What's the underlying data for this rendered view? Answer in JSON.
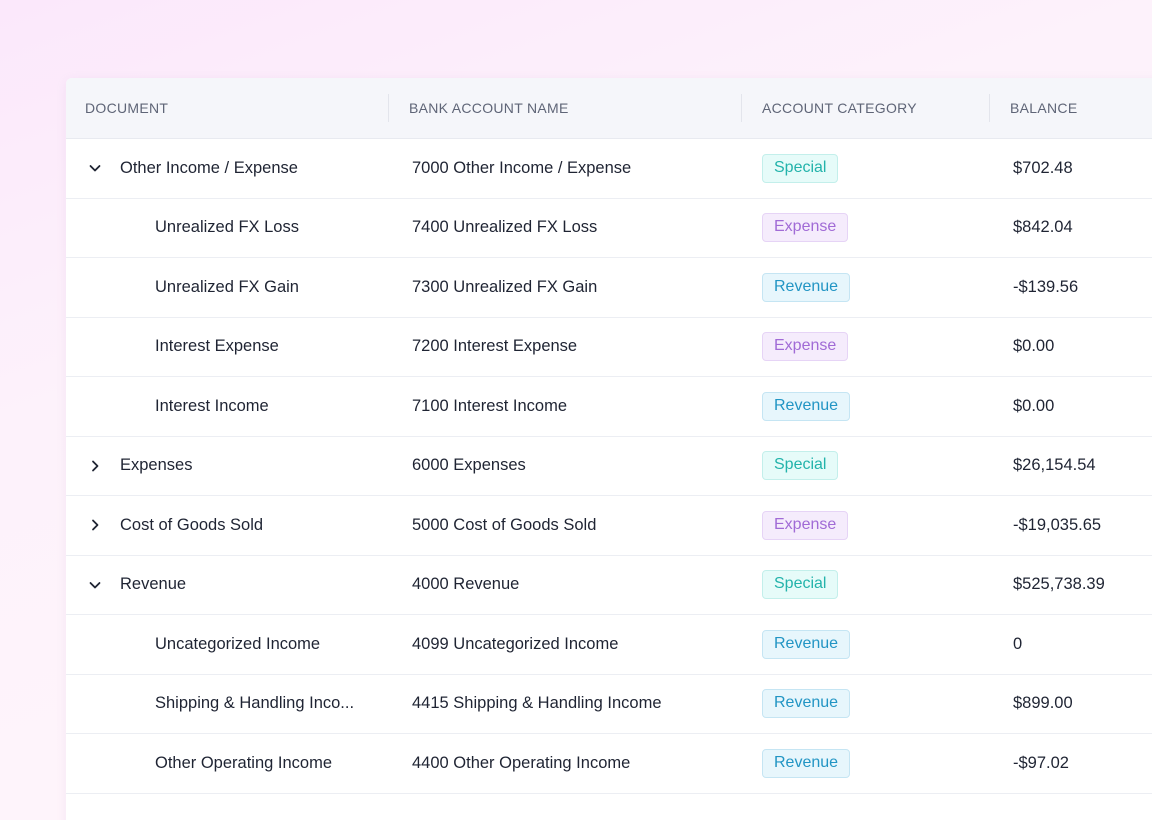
{
  "columns": {
    "document": "DOCUMENT",
    "bank_account_name": "BANK ACCOUNT NAME",
    "account_category": "ACCOUNT CATEGORY",
    "balance": "BALANCE"
  },
  "rows": [
    {
      "document": "Other Income / Expense",
      "account": "7000 Other Income / Expense",
      "category": "Special",
      "balance": "$702.48",
      "expander": "expanded"
    },
    {
      "document": "Unrealized FX Loss",
      "account": "7400 Unrealized FX Loss",
      "category": "Expense",
      "balance": "$842.04",
      "expander": "none"
    },
    {
      "document": "Unrealized FX Gain",
      "account": "7300 Unrealized FX Gain",
      "category": "Revenue",
      "balance": "-$139.56",
      "expander": "none"
    },
    {
      "document": "Interest Expense",
      "account": "7200 Interest Expense",
      "category": "Expense",
      "balance": "$0.00",
      "expander": "none"
    },
    {
      "document": "Interest Income",
      "account": "7100 Interest Income",
      "category": "Revenue",
      "balance": "$0.00",
      "expander": "none"
    },
    {
      "document": "Expenses",
      "account": "6000 Expenses",
      "category": "Special",
      "balance": "$26,154.54",
      "expander": "collapsed"
    },
    {
      "document": "Cost of Goods Sold",
      "account": "5000 Cost of Goods Sold",
      "category": "Expense",
      "balance": "-$19,035.65",
      "expander": "collapsed"
    },
    {
      "document": "Revenue",
      "account": "4000 Revenue",
      "category": "Special",
      "balance": "$525,738.39",
      "expander": "expanded"
    },
    {
      "document": "Uncategorized Income",
      "account": "4099 Uncategorized Income",
      "category": "Revenue",
      "balance": "0",
      "expander": "none"
    },
    {
      "document": "Shipping & Handling Inco...",
      "account": "4415 Shipping & Handling Income",
      "category": "Revenue",
      "balance": "$899.00",
      "expander": "none"
    },
    {
      "document": "Other Operating Income",
      "account": "4400 Other Operating Income",
      "category": "Revenue",
      "balance": "-$97.02",
      "expander": "none"
    }
  ],
  "colors": {
    "special": "#23b3ab",
    "expense": "#a16bd6",
    "revenue": "#2295c4"
  }
}
